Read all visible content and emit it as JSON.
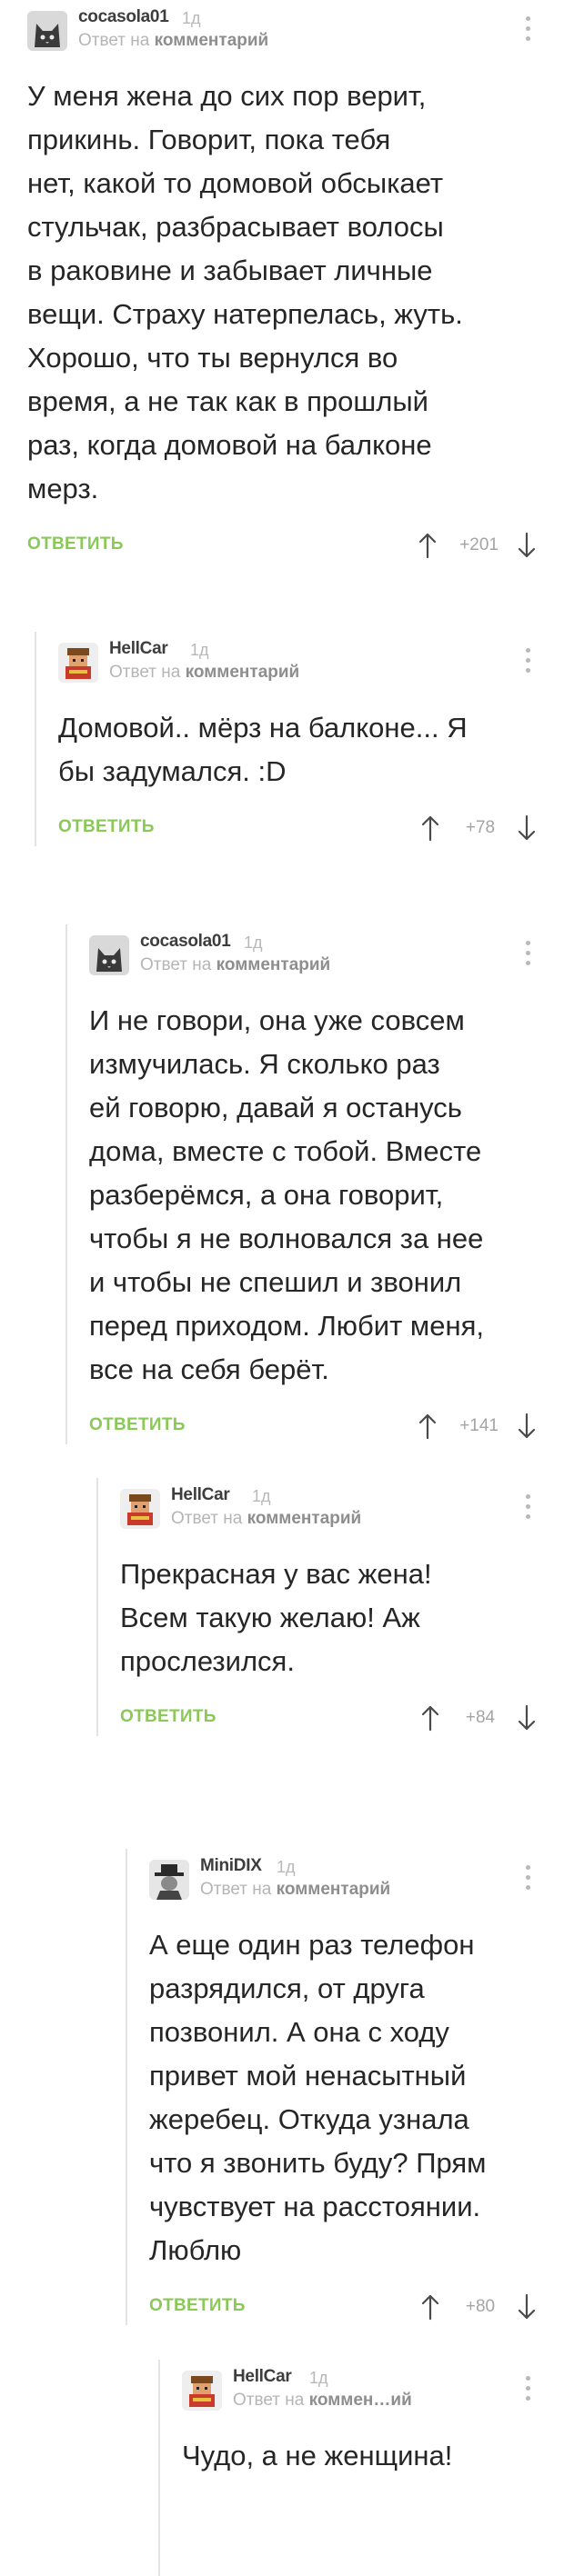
{
  "labels": {
    "reply_to": "Ответ на",
    "comment": "комментарий",
    "comment_truncated": "коммен…ий",
    "reply_button": "ОТВЕТИТЬ"
  },
  "colors": {
    "reply_button": "#8ac858",
    "thread_line": "#e3e3e3",
    "meta_text": "#b5b5b5"
  },
  "comments": [
    {
      "author": "cocasola01",
      "ago": "1д",
      "avatar": "cat-avatar",
      "text": "У меня жена до сих пор верит,\nприкинь. Говорит, пока тебя\nнет, какой то домовой обсыкает\nстульчак, разбрасывает волосы\nв раковине и забывает личные\nвещи. Страху натерпелась, жуть.\nХорошо, что ты вернулся во\nвремя, а не так как в прошлый\nраз, когда домовой на балконе\nмерз.",
      "score": "+201"
    },
    {
      "author": "HellCar",
      "ago": "1д",
      "avatar": "pixel-character-avatar",
      "text": "Домовой.. мёрз на балконе... Я\nбы задумался. :D",
      "score": "+78"
    },
    {
      "author": "cocasola01",
      "ago": "1д",
      "avatar": "cat-avatar",
      "text": "И не говори, она уже совсем\nизмучилась. Я сколько раз\nей говорю, давай я останусь\nдома, вместе с тобой. Вместе\nразберёмся, а она говорит,\nчтобы я не волновался за нее\nи чтобы не спешил и звонил\nперед приходом. Любит меня,\nвсе на себя берёт.",
      "score": "+141"
    },
    {
      "author": "HellCar",
      "ago": "1д",
      "avatar": "pixel-character-avatar",
      "text": "Прекрасная у вас жена!\nВсем такую желаю! Аж\nпрослезился.",
      "score": "+84"
    },
    {
      "author": "MiniDIX",
      "ago": "1д",
      "avatar": "hat-figure-avatar",
      "text": "А еще один раз телефон\nразрядился, от друга\nпозвонил. А она с ходу\nпривет мой ненасытный\nжеребец. Откуда узнала\nчто я звонить буду? Прям\nчувствует на расстоянии.\nЛюблю",
      "score": "+80"
    },
    {
      "author": "HellCar",
      "ago": "1д",
      "avatar": "pixel-character-avatar",
      "text": "Чудо, а не женщина!"
    }
  ]
}
